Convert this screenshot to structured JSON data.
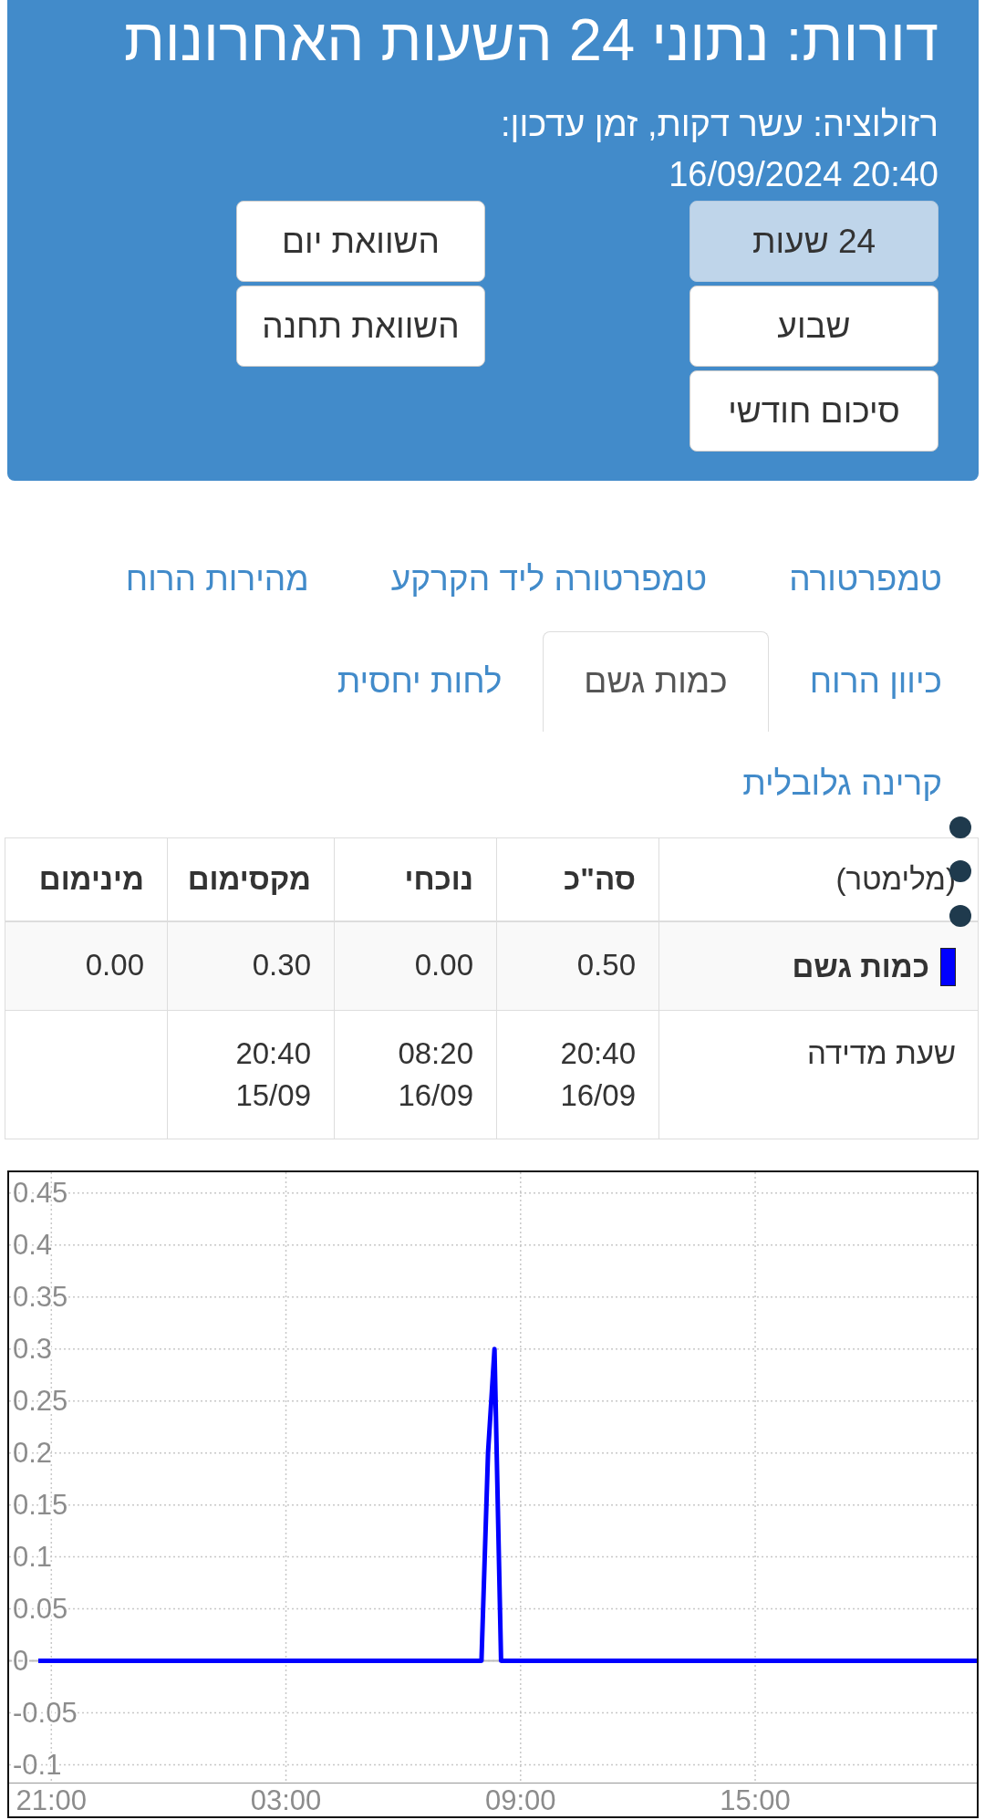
{
  "header": {
    "title": "דורות: נתוני 24 השעות האחרונות",
    "subtitle": "רזולוציה: עשר דקות, זמן עדכון:",
    "updated": "16/09/2024 20:40",
    "period_buttons": [
      {
        "label": "24 שעות",
        "selected": true
      },
      {
        "label": "שבוע",
        "selected": false
      },
      {
        "label": "סיכום חודשי",
        "selected": false
      }
    ],
    "compare_buttons": [
      {
        "label": "השוואת יום",
        "selected": false
      },
      {
        "label": "השוואת תחנה",
        "selected": false
      }
    ]
  },
  "tabs": [
    {
      "label": "טמפרטורה",
      "selected": false
    },
    {
      "label": "טמפרטורה ליד הקרקע",
      "selected": false
    },
    {
      "label": "מהירות הרוח",
      "selected": false
    },
    {
      "label": "כיוון הרוח",
      "selected": false
    },
    {
      "label": "כמות גשם",
      "selected": true
    },
    {
      "label": "לחות יחסית",
      "selected": false
    },
    {
      "label": "קרינה גלובלית",
      "selected": false
    }
  ],
  "table": {
    "columns": [
      "(מלימטר)",
      "סה\"כ",
      "נוכחי",
      "מקסימום",
      "מינימום"
    ],
    "rows": [
      {
        "kind": "series",
        "color": "#0000ff",
        "cells": [
          "כמות גשם",
          "0.50",
          "0.00",
          "0.30",
          "0.00"
        ]
      },
      {
        "kind": "time",
        "cells": [
          "שעת מדידה",
          "20:40 16/09",
          "08:20 16/09",
          "20:40 15/09"
        ]
      }
    ]
  },
  "chart": {
    "chart_data": {
      "type": "line",
      "grid": true,
      "categories": [
        null,
        null,
        "21:00",
        null,
        null,
        null,
        null,
        null,
        null,
        null,
        null,
        null,
        null,
        null,
        null,
        null,
        null,
        null,
        null,
        null,
        null,
        null,
        null,
        null,
        null,
        null,
        null,
        null,
        null,
        null,
        null,
        null,
        null,
        null,
        null,
        null,
        null,
        null,
        "03:00",
        null,
        null,
        null,
        null,
        null,
        null,
        null,
        null,
        null,
        null,
        null,
        null,
        null,
        null,
        null,
        null,
        null,
        null,
        null,
        null,
        null,
        null,
        null,
        null,
        null,
        null,
        null,
        null,
        null,
        null,
        null,
        null,
        null,
        null,
        null,
        "09:00",
        null,
        null,
        null,
        null,
        null,
        null,
        null,
        null,
        null,
        null,
        null,
        null,
        null,
        null,
        null,
        null,
        null,
        null,
        null,
        null,
        null,
        null,
        null,
        null,
        null,
        null,
        null,
        null,
        null,
        null,
        null,
        null,
        null,
        null,
        null,
        "15:00",
        null,
        null,
        null,
        null,
        null,
        null,
        null,
        null,
        null,
        null,
        null,
        null,
        null,
        null,
        null,
        null,
        null,
        null,
        null,
        null,
        null,
        null,
        null,
        null,
        null,
        null,
        null,
        null,
        null,
        null,
        null,
        null,
        null,
        null
      ],
      "series": [
        {
          "color": "#0000ff",
          "values": [
            0,
            0,
            0,
            0,
            0,
            0,
            0,
            0,
            0,
            0,
            0,
            0,
            0,
            0,
            0,
            0,
            0,
            0,
            0,
            0,
            0,
            0,
            0,
            0,
            0,
            0,
            0,
            0,
            0,
            0,
            0,
            0,
            0,
            0,
            0,
            0,
            0,
            0,
            0,
            0,
            0,
            0,
            0,
            0,
            0,
            0,
            0,
            0,
            0,
            0,
            0,
            0,
            0,
            0,
            0,
            0,
            0,
            0,
            0,
            0,
            0,
            0,
            0,
            0,
            0,
            0,
            0,
            0,
            0,
            0.2,
            0.3,
            0,
            0,
            0,
            0,
            0,
            0,
            0,
            0,
            0,
            0,
            0,
            0,
            0,
            0,
            0,
            0,
            0,
            0,
            0,
            0,
            0,
            0,
            0,
            0,
            0,
            0,
            0,
            0,
            0,
            0,
            0,
            0,
            0,
            0,
            0,
            0,
            0,
            0,
            0,
            0,
            0,
            0,
            0,
            0,
            0,
            0,
            0,
            0,
            0,
            0,
            0,
            0,
            0,
            0,
            0,
            0,
            0,
            0,
            0,
            0,
            0,
            0,
            0,
            0,
            0,
            0,
            0,
            0,
            0,
            0,
            0,
            0,
            0,
            0
          ]
        }
      ],
      "ylim": [
        -0.118,
        0.47
      ],
      "yticks": [
        -0.1,
        -0.05,
        0,
        0.05,
        0.1,
        0.15,
        0.2,
        0.25,
        0.3,
        0.35,
        0.4,
        0.45
      ]
    }
  }
}
